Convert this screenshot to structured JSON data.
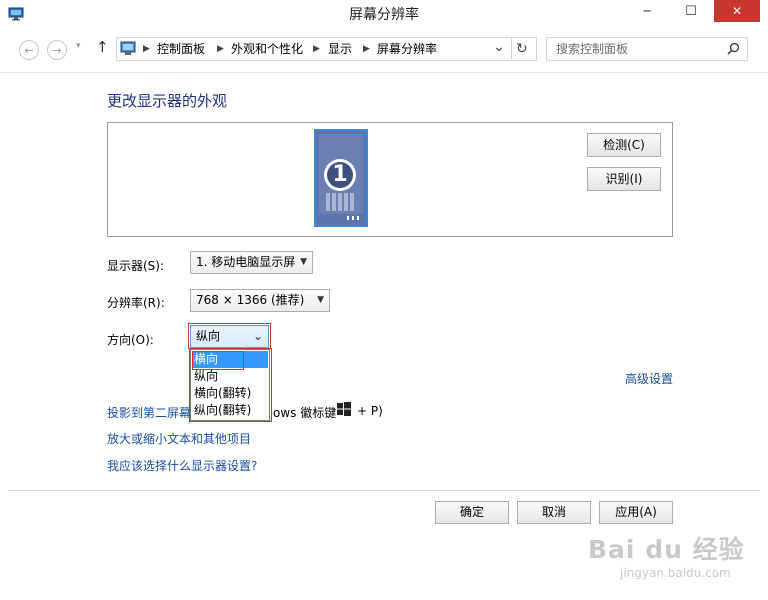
{
  "window": {
    "title": "屏幕分辨率",
    "minimize_glyph": "─",
    "maximize_glyph": "☐",
    "close_glyph": "✕"
  },
  "nav": {
    "back_glyph": "←",
    "forward_glyph": "→",
    "up_glyph": "↑",
    "history_glyph": "▾",
    "breadcrumbs": [
      "控制面板",
      "外观和个性化",
      "显示",
      "屏幕分辨率"
    ],
    "crumb_separator": "▶",
    "dropdown_glyph": "⌄",
    "refresh_glyph": "↻",
    "search_placeholder": "搜索控制面板",
    "search_glyph": "⚲"
  },
  "main": {
    "heading": "更改显示器的外观",
    "monitor_number": "1",
    "detect_button": "检测(C)",
    "identify_button": "识别(I)",
    "display_label": "显示器(S):",
    "display_value": "1. 移动电脑显示屏",
    "resolution_label": "分辨率(R):",
    "resolution_value": "768 × 1366 (推荐)",
    "orientation_label": "方向(O):",
    "orientation_value": "纵向",
    "orientation_options": [
      "横向",
      "纵向",
      "横向(翻转)",
      "纵向(翻转)"
    ],
    "advanced_link": "高级设置",
    "project_link": "投影到第二屏幕",
    "project_rest_a": "ows 徽标键",
    "project_rest_b": "+ P)",
    "text_size_link": "放大或缩小文本和其他项目",
    "which_settings_link": "我应该选择什么显示器设置?"
  },
  "footer": {
    "ok_button": "确定",
    "cancel_button": "取消",
    "apply_button": "应用(A)"
  },
  "watermark": {
    "brand": "Bai du 经验",
    "url": "jingyan.baidu.com"
  },
  "colors": {
    "heading": "#1e3287",
    "link": "#1a4ea6",
    "close_button": "#c7362f",
    "selection": "#3399ff",
    "highlight_box": "#d0333b",
    "monitor_fill": "#5b74aa",
    "monitor_border": "#3d85d8"
  }
}
